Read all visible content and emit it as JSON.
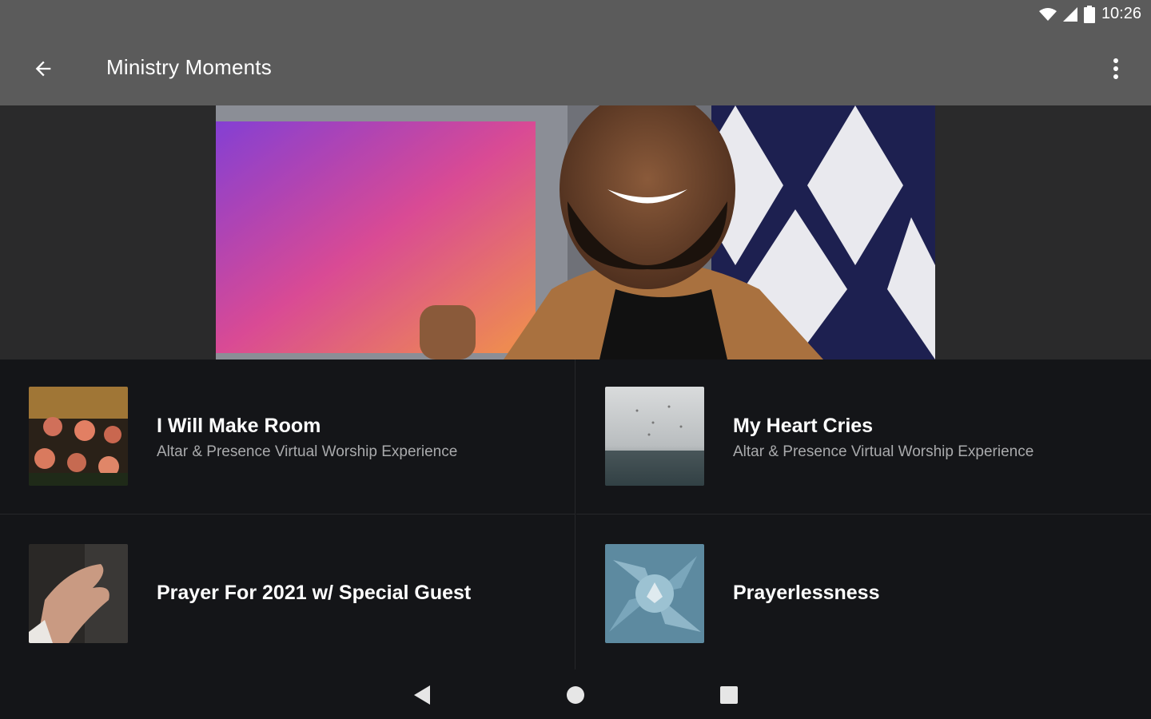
{
  "status_bar": {
    "time": "10:26"
  },
  "app_bar": {
    "title": "Ministry Moments"
  },
  "hero": {},
  "items": [
    {
      "title": "I Will Make Room",
      "subtitle": "Altar & Presence Virtual Worship Experience"
    },
    {
      "title": "My Heart Cries",
      "subtitle": "Altar & Presence Virtual Worship Experience"
    },
    {
      "title": "Prayer For 2021 w/ Special Guest",
      "subtitle": ""
    },
    {
      "title": "Prayerlessness",
      "subtitle": ""
    }
  ],
  "colors": {
    "app_bar": "#5b5b5b",
    "background": "#151618",
    "subtitle": "#a9aaac"
  }
}
